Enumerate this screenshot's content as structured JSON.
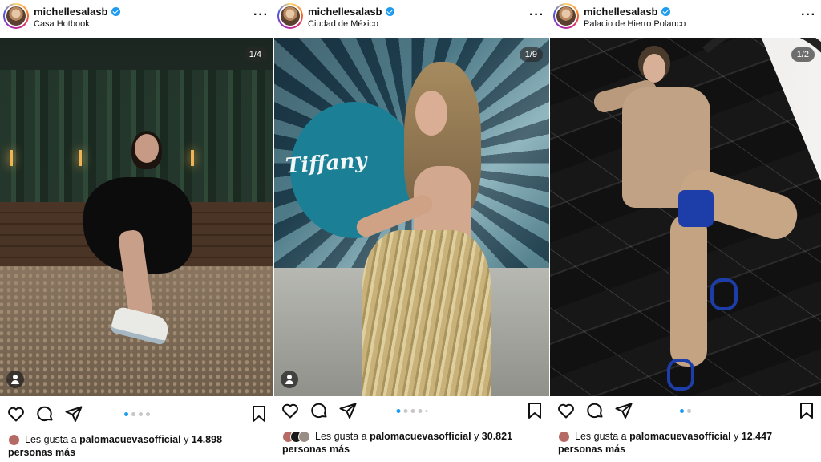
{
  "posts": [
    {
      "username": "michellesalasb",
      "location": "Casa Hotbook",
      "counter": "1/4",
      "dots": 4,
      "active_dot": 0,
      "likes_prefix": "Les gusta a",
      "likes_user": "palomacuevasofficial",
      "likes_mid": "y",
      "likes_count": "14.898",
      "likes_suffix": "personas más",
      "liker_avatars": [
        "#b56a63"
      ]
    },
    {
      "username": "michellesalasb",
      "location": "Ciudad de México",
      "counter": "1/9",
      "dots": 5,
      "active_dot": 0,
      "likes_prefix": "Les gusta a",
      "likes_user": "palomacuevasofficial",
      "likes_mid": "y",
      "likes_count": "30.821",
      "likes_suffix": "personas más",
      "liker_avatars": [
        "#b56a63",
        "#1a1a1a",
        "#9a8d84"
      ]
    },
    {
      "username": "michellesalasb",
      "location": "Palacio de Hierro Polanco",
      "counter": "1/2",
      "dots": 2,
      "active_dot": 0,
      "likes_prefix": "Les gusta a",
      "likes_user": "palomacuevasofficial",
      "likes_mid": "y",
      "likes_count": "12.447",
      "likes_suffix": "personas más",
      "liker_avatars": [
        "#b56a63"
      ]
    }
  ],
  "icons": {
    "like": "heart-icon",
    "comment": "comment-icon",
    "share": "share-icon",
    "save": "bookmark-icon",
    "more": "more-options-icon",
    "verified": "verified-badge-icon",
    "tag": "user-tag-icon"
  },
  "colors": {
    "verified": "#1d9bf0",
    "active_dot": "#1d9bf0",
    "inactive_dot": "#c7c7c7"
  }
}
